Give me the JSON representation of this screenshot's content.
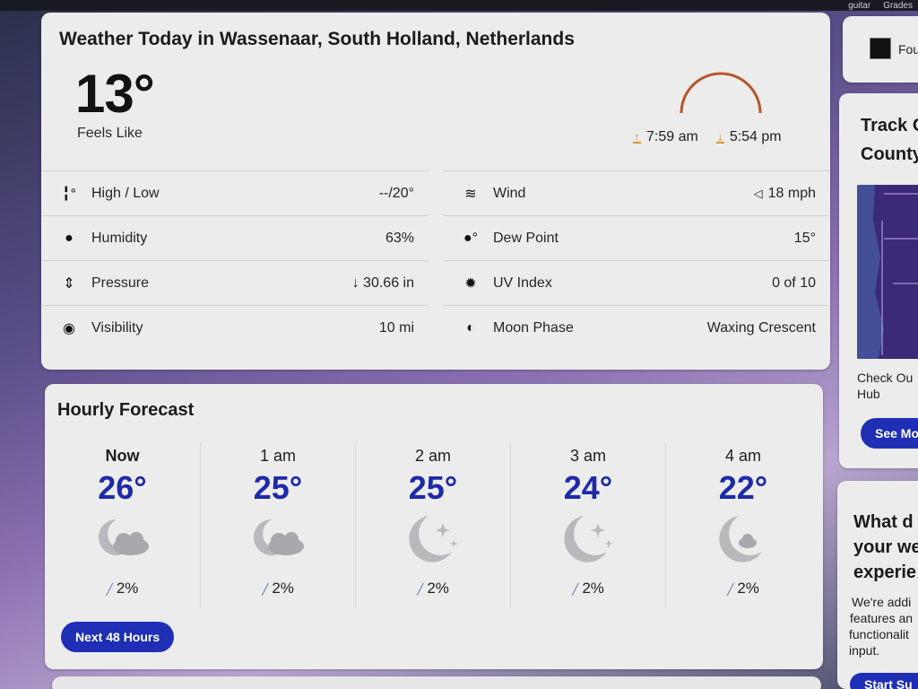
{
  "topbar": {
    "item1": "guitar",
    "item2": "Grades"
  },
  "today": {
    "title": "Weather Today in Wassenaar, South Holland, Netherlands",
    "temperature": "13°",
    "feels_like_label": "Feels Like",
    "sunrise": "7:59 am",
    "sunset": "5:54 pm",
    "details_left": [
      {
        "icon": "thermometer-icon",
        "label": "High / Low",
        "value": "--/20°"
      },
      {
        "icon": "humidity-drop-icon",
        "label": "Humidity",
        "value": "63%"
      },
      {
        "icon": "pressure-icon",
        "label": "Pressure",
        "value": "↓ 30.66 in"
      },
      {
        "icon": "visibility-eye-icon",
        "label": "Visibility",
        "value": "10 mi"
      }
    ],
    "details_right": [
      {
        "icon": "wind-icon",
        "label": "Wind",
        "value": "18 mph"
      },
      {
        "icon": "dew-point-icon",
        "label": "Dew Point",
        "value": "15°"
      },
      {
        "icon": "uv-index-icon",
        "label": "UV Index",
        "value": "0 of 10"
      },
      {
        "icon": "moon-phase-icon",
        "label": "Moon Phase",
        "value": "Waxing Crescent"
      }
    ]
  },
  "hourly": {
    "title": "Hourly Forecast",
    "hours": [
      {
        "time": "Now",
        "temp": "26°",
        "icon": "partly-cloudy-night-icon",
        "precip": "2%"
      },
      {
        "time": "1 am",
        "temp": "25°",
        "icon": "partly-cloudy-night-icon",
        "precip": "2%"
      },
      {
        "time": "2 am",
        "temp": "25°",
        "icon": "clear-night-icon",
        "precip": "2%"
      },
      {
        "time": "3 am",
        "temp": "24°",
        "icon": "clear-night-icon",
        "precip": "2%"
      },
      {
        "time": "4 am",
        "temp": "22°",
        "icon": "mostly-clear-night-icon",
        "precip": "2%"
      }
    ],
    "button_label": "Next 48 Hours"
  },
  "sidebar": {
    "card1_text": "Fou",
    "card2_title_line1": "Track C",
    "card2_title_line2": "County",
    "card2_caption_line1": "Check Ou",
    "card2_caption_line2": "Hub",
    "card2_button": "See Mo",
    "card3_title_line1": "What d",
    "card3_title_line2": "your we",
    "card3_title_line3": "experie",
    "card3_body_line1": "We're addi",
    "card3_body_line2": "features an",
    "card3_body_line3": "functionalit",
    "card3_body_line4": "input.",
    "card3_button": "Start Su"
  },
  "colors": {
    "accent_blue": "#1e2fb6",
    "temp_blue": "#1e2aa8",
    "sun_orange": "#d89a2c",
    "arc_brown": "#b5552a"
  }
}
